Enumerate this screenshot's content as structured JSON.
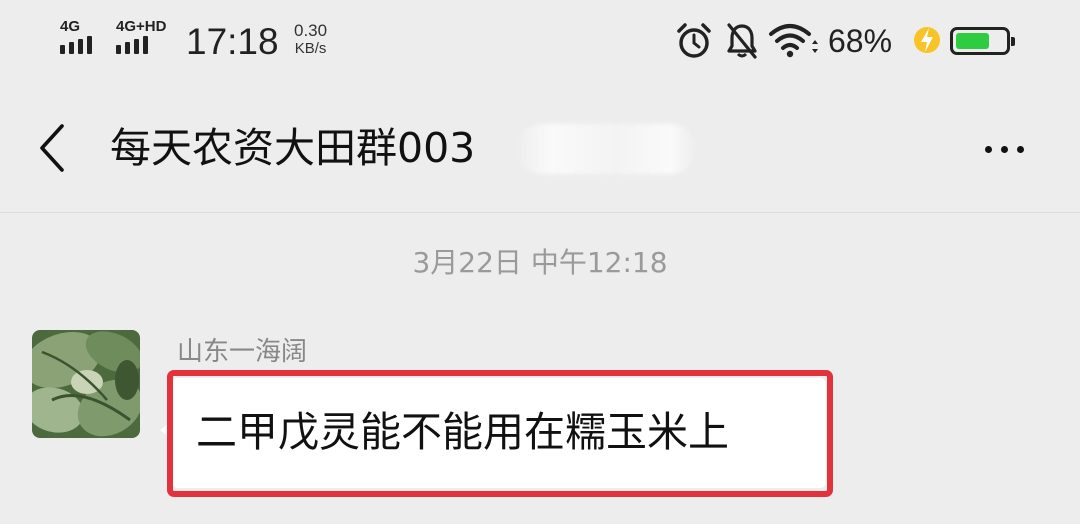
{
  "status_bar": {
    "signal_1_label": "4G",
    "signal_2_label": "4G+HD",
    "time": "17:18",
    "net_speed_value": "0.30",
    "net_speed_unit": "KB/s",
    "battery_percent": "68%",
    "battery_level": 0.68,
    "battery_color": "#2ecc40",
    "icons": [
      "alarm-icon",
      "mute-bell-icon",
      "wifi-icon",
      "charging-icon",
      "battery-icon"
    ]
  },
  "header": {
    "back_icon": "chevron-left-icon",
    "title": "每天农资大田群003",
    "more_icon": "more-dots-icon"
  },
  "chat": {
    "timestamp": "3月22日 中午12:18",
    "messages": [
      {
        "sender": "山东一海阔",
        "text": "二甲戊灵能不能用在糯玉米上",
        "highlight_color": "#e2323c"
      }
    ]
  }
}
